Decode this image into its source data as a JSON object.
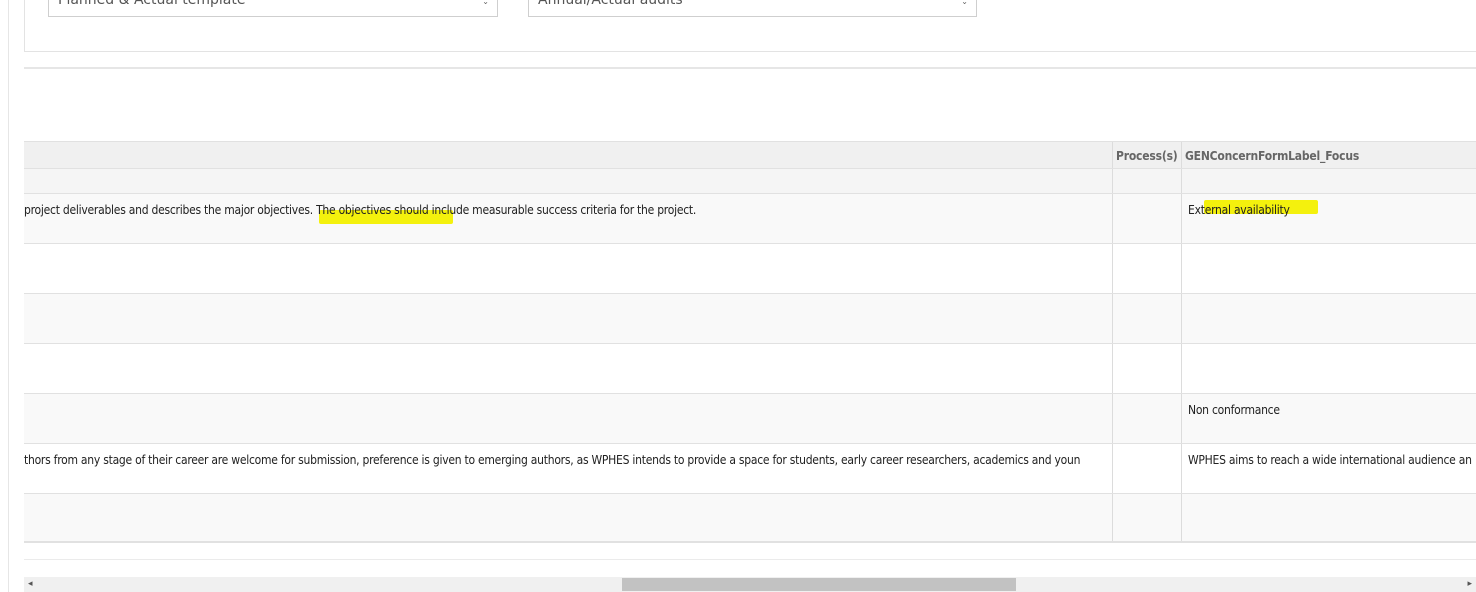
{
  "filters": {
    "template_select": "Planned & Actual template",
    "audit_select": "Annual/Actual audits"
  },
  "grid": {
    "columns": [
      "Process(s)",
      "GENConcernFormLabel_Focus"
    ],
    "rows": [
      {
        "description": "project deliverables and describes the major objectives. The objectives should include measurable success criteria for the project.",
        "process": "",
        "focus": "External availability"
      },
      {
        "description": "",
        "process": "",
        "focus": ""
      },
      {
        "description": "",
        "process": "",
        "focus": ""
      },
      {
        "description": "",
        "process": "",
        "focus": ""
      },
      {
        "description": "",
        "process": "",
        "focus": "Non conformance"
      },
      {
        "description": "thors from any stage of their career are welcome for submission, preference is given to emerging authors, as WPHES intends to provide a space for students, early career researchers, academics and youn",
        "process": "",
        "focus": "WPHES aims to reach a wide international audience an"
      },
      {
        "description": "",
        "process": "",
        "focus": ""
      }
    ]
  },
  "scrollbar": {
    "left_icon": "arrow-left-icon",
    "right_icon": "arrow-right-icon",
    "arrow_left": "◂",
    "arrow_right": "▸"
  },
  "icons": {
    "dropdown": "chevron-down-icon",
    "dropdown_glyph": "⌄"
  },
  "colors": {
    "highlight": "#f3f000"
  }
}
